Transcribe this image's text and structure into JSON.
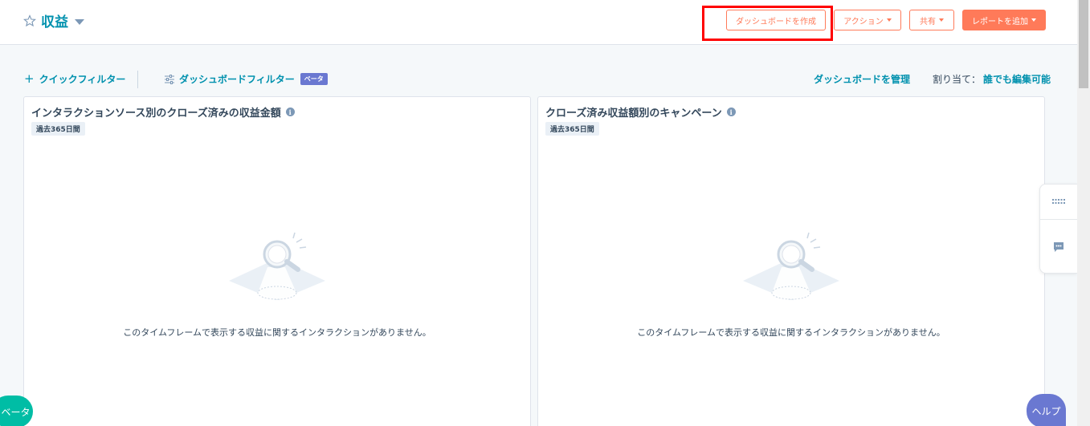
{
  "header": {
    "title": "収益",
    "create_dashboard_label": "ダッシュボードを作成",
    "actions_label": "アクション",
    "share_label": "共有",
    "add_report_label": "レポートを追加"
  },
  "filters": {
    "quick_filter_label": "クイックフィルター",
    "dashboard_filter_label": "ダッシュボードフィルター",
    "beta_badge": "ベータ",
    "manage_dashboard_label": "ダッシュボードを管理",
    "assign_label": "割り当て：",
    "assign_value": "誰でも編集可能"
  },
  "cards": [
    {
      "title": "インタラクションソース別のクローズ済みの収益金額",
      "date_range": "過去365日間",
      "empty_message": "このタイムフレームで表示する収益に関するインタラクションがありません。"
    },
    {
      "title": "クローズ済み収益額別のキャンペーン",
      "date_range": "過去365日間",
      "empty_message": "このタイムフレームで表示する収益に関するインタラクションがありません。"
    }
  ],
  "floating": {
    "beta_pill": "ベータ",
    "help_pill": "ヘルプ"
  },
  "colors": {
    "accent": "#ff7a59",
    "link": "#0091ae",
    "highlight": "#ff0000",
    "beta": "#6a78d1",
    "teal": "#00bda5"
  },
  "icons": [
    "star-icon",
    "chevron-down-icon",
    "plus-icon",
    "sliders-icon",
    "info-icon",
    "magnifier-illustration",
    "grid-icon",
    "chat-icon"
  ]
}
